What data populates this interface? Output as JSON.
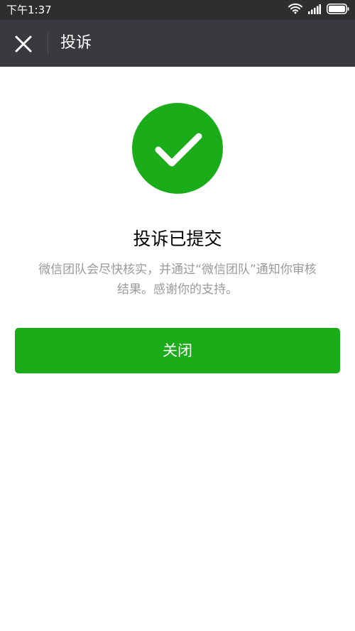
{
  "status_bar": {
    "time": "下午1:37",
    "icons": [
      "wifi-icon",
      "signal-icon",
      "battery-icon"
    ]
  },
  "nav": {
    "title": "投诉",
    "close_icon": "close-icon"
  },
  "result": {
    "icon": "checkmark-icon",
    "title": "投诉已提交",
    "description_line1": "微信团队会尽快核实，并通过“微信团队”通知你审核",
    "description_line2": "结果。感谢你的支持。"
  },
  "button": {
    "label": "关闭"
  },
  "colors": {
    "status_bar_bg": "#2e2e2e",
    "nav_bg": "#393a3f",
    "accent_green": "#1aad19",
    "desc_text": "#9a9a9a"
  }
}
